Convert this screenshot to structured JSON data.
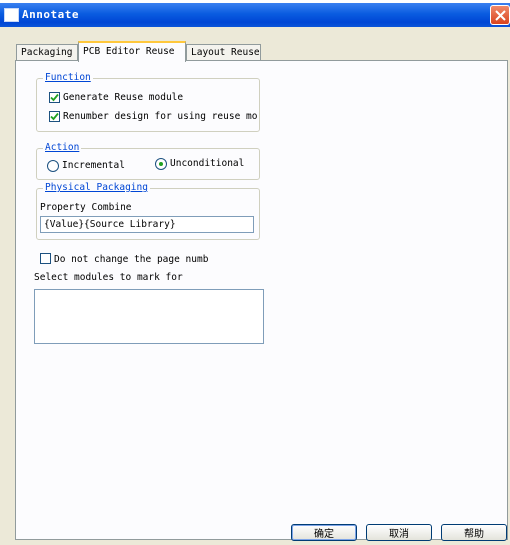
{
  "window": {
    "title": "Annotate"
  },
  "tabs": [
    {
      "label": "Packaging",
      "active": false
    },
    {
      "label": "PCB Editor Reuse",
      "active": true
    },
    {
      "label": "Layout Reuse",
      "active": false
    }
  ],
  "function_group": {
    "label": "Function",
    "generate_reuse": {
      "label": "Generate Reuse module",
      "checked": true
    },
    "renumber": {
      "label": "Renumber design for using reuse mo",
      "checked": true
    }
  },
  "action_group": {
    "label": "Action",
    "incremental": {
      "label": "Incremental",
      "selected": false
    },
    "unconditional": {
      "label": "Unconditional",
      "selected": true
    }
  },
  "physical_group": {
    "label": "Physical Packaging",
    "property_combine_label": "Property Combine",
    "property_combine_value": "{Value}{Source Library}"
  },
  "page_number_checkbox": {
    "label": "Do not change the page numb",
    "checked": false
  },
  "select_modules": {
    "label": "Select modules to mark for",
    "items": []
  },
  "buttons": {
    "ok": "确定",
    "cancel": "取消",
    "help": "帮助"
  },
  "colors": {
    "titlebar": "#0a5ce0",
    "dialog_bg": "#ece9d8",
    "group_label": "#0046d5",
    "check_mark": "#21a121",
    "active_tab_accent": "#ffc83c"
  }
}
